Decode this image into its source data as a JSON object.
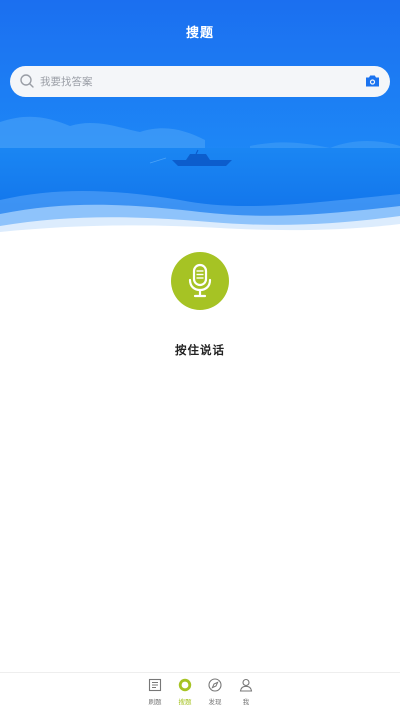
{
  "header": {
    "title": "搜题"
  },
  "search": {
    "placeholder": "我要找答案",
    "value": ""
  },
  "voice": {
    "label": "按住说话"
  },
  "tabbar": {
    "active": "搜题",
    "items": [
      {
        "label": "刷题",
        "icon": "book-icon"
      },
      {
        "label": "搜题",
        "icon": "circle-icon"
      },
      {
        "label": "发现",
        "icon": "compass-icon"
      },
      {
        "label": "我",
        "icon": "person-icon"
      }
    ]
  },
  "colors": {
    "primary": "#1a73f0",
    "accent": "#a6c324",
    "tab_inactive": "#777777"
  }
}
